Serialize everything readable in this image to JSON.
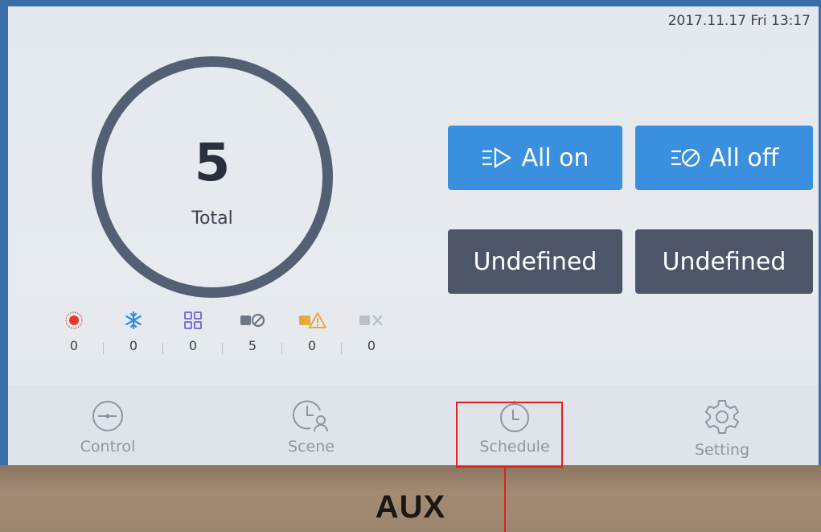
{
  "status_bar": {
    "datetime": "2017.11.17 Fri 13:17"
  },
  "summary": {
    "count": "5",
    "label": "Total"
  },
  "stats": [
    {
      "icon": "heating-icon",
      "value": "0",
      "color": "#e0382a"
    },
    {
      "icon": "cooling-snowflake-icon",
      "value": "0",
      "color": "#2f8fe0"
    },
    {
      "icon": "grid-mode-icon",
      "value": "0",
      "color": "#7a6fd8"
    },
    {
      "icon": "offline-unit-icon",
      "value": "5",
      "color": "#6f7786"
    },
    {
      "icon": "warning-unit-icon",
      "value": "0",
      "color": "#e9a93a"
    },
    {
      "icon": "error-unit-icon",
      "value": "0",
      "color": "#b9c0ca"
    }
  ],
  "commands": {
    "all_on": "All on",
    "all_off": "All off",
    "undefined_1": "Undefined",
    "undefined_2": "Undefined"
  },
  "nav": {
    "control": "Control",
    "scene": "Scene",
    "schedule": "Schedule",
    "setting": "Setting"
  },
  "brand": {
    "logo": "AUX"
  },
  "colors": {
    "primary_button": "#3a8fdf",
    "secondary_button": "#4d5669",
    "highlight": "#e0211d"
  }
}
